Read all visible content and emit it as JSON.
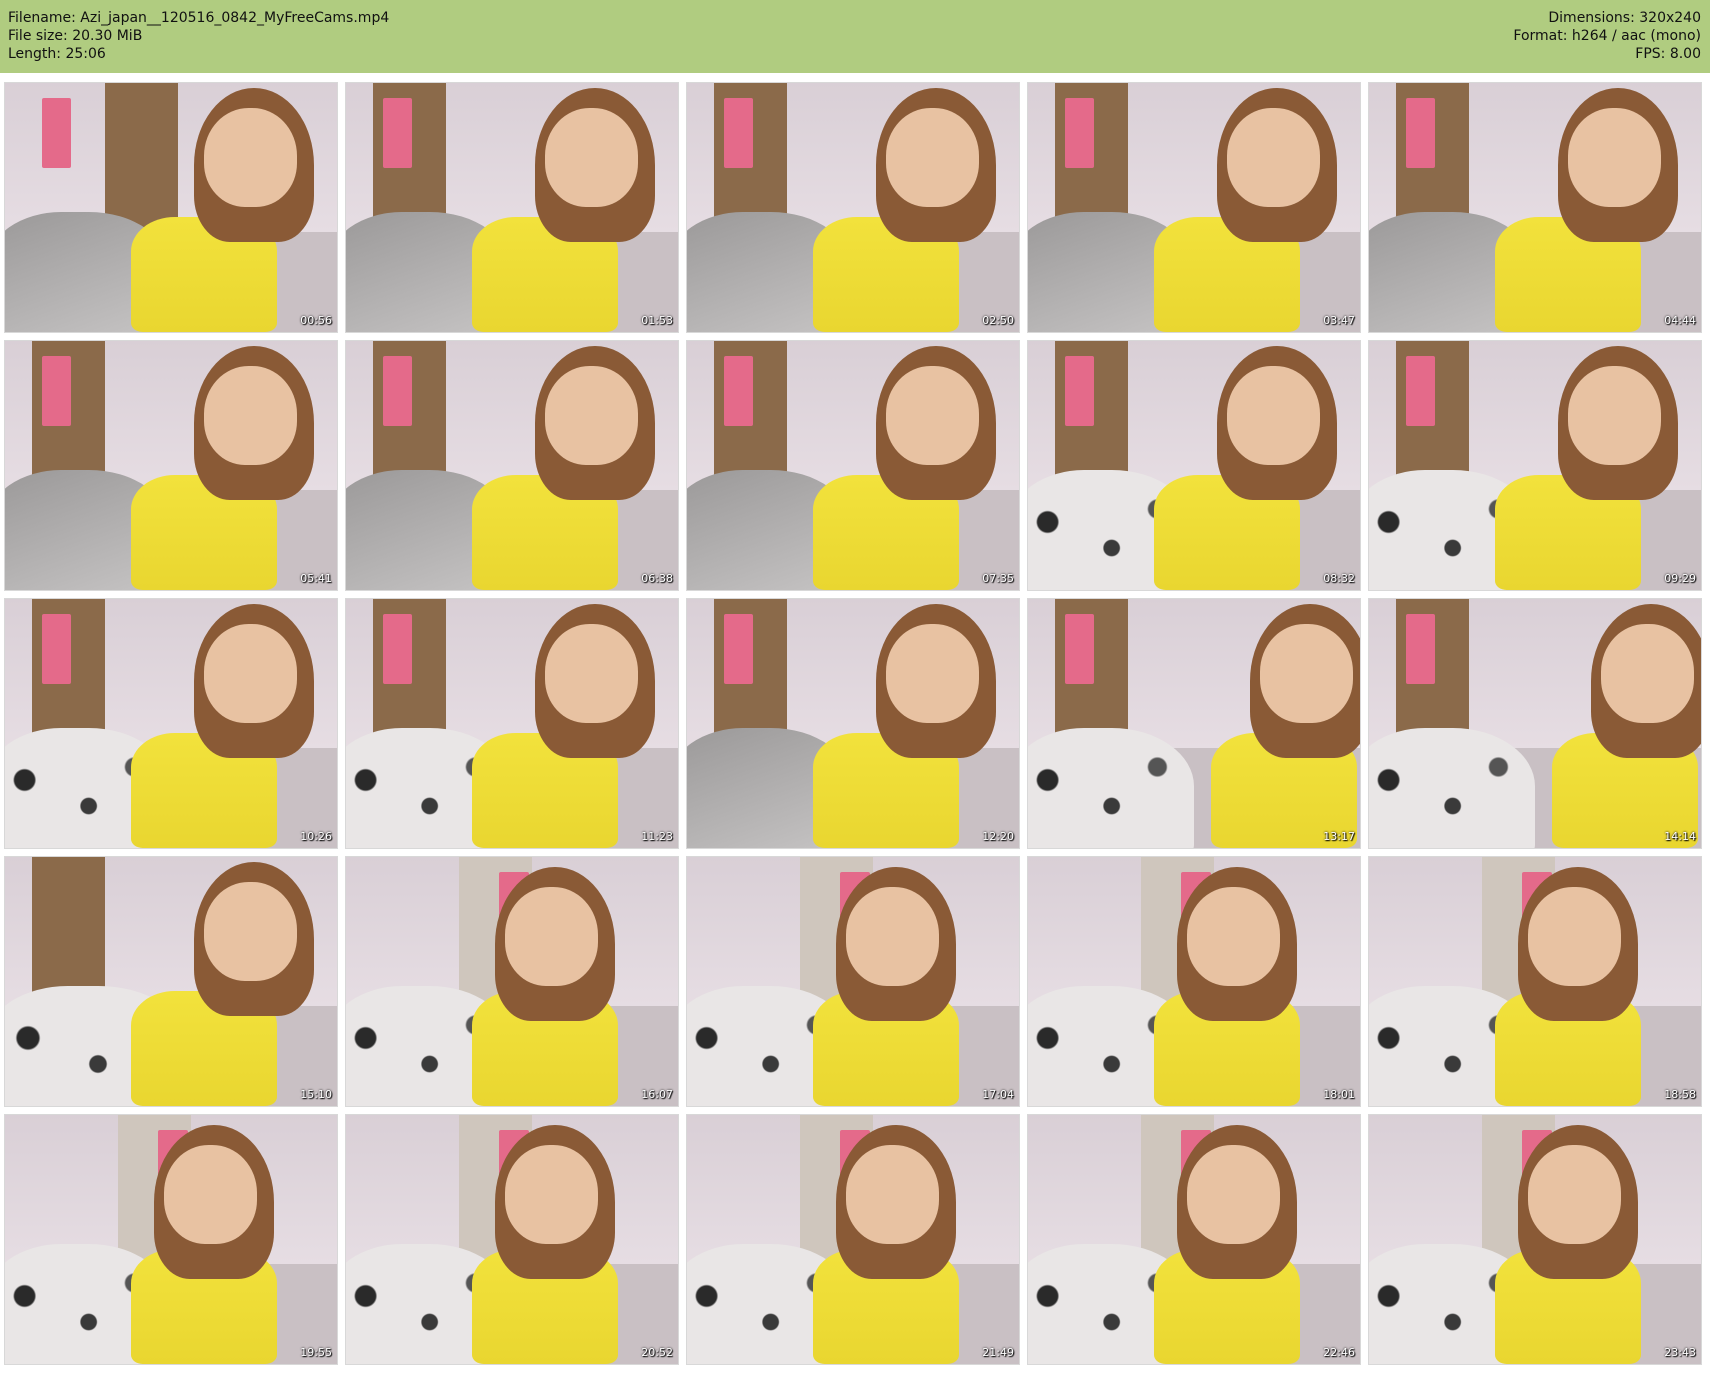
{
  "header": {
    "filename": "Filename: Azi_japan__120516_0842_MyFreeCams.mp4",
    "filesize": "File size: 20.30 MiB",
    "length": "Length: 25:06",
    "dimensions": "Dimensions: 320x240",
    "format": "Format: h264 / aac (mono)",
    "fps": "FPS: 8.00"
  },
  "thumbnails": [
    {
      "time": "00:56",
      "scene": "room-a"
    },
    {
      "time": "01:53",
      "scene": "room-b"
    },
    {
      "time": "02:50",
      "scene": "room-b"
    },
    {
      "time": "03:47",
      "scene": "room-b"
    },
    {
      "time": "04:44",
      "scene": "room-b"
    },
    {
      "time": "05:41",
      "scene": "room-b"
    },
    {
      "time": "06:38",
      "scene": "room-b"
    },
    {
      "time": "07:35",
      "scene": "room-b"
    },
    {
      "time": "08:32",
      "scene": "room-c"
    },
    {
      "time": "09:29",
      "scene": "room-c"
    },
    {
      "time": "10:26",
      "scene": "room-c"
    },
    {
      "time": "11:23",
      "scene": "room-c"
    },
    {
      "time": "12:20",
      "scene": "room-b"
    },
    {
      "time": "13:17",
      "scene": "room-d"
    },
    {
      "time": "14:14",
      "scene": "room-d"
    },
    {
      "time": "15:10",
      "scene": "room-e"
    },
    {
      "time": "16:07",
      "scene": "room-f"
    },
    {
      "time": "17:04",
      "scene": "room-f"
    },
    {
      "time": "18:01",
      "scene": "room-f"
    },
    {
      "time": "18:58",
      "scene": "room-f"
    },
    {
      "time": "19:55",
      "scene": "room-f"
    },
    {
      "time": "20:52",
      "scene": "room-f"
    },
    {
      "time": "21:49",
      "scene": "room-f"
    },
    {
      "time": "22:46",
      "scene": "room-f"
    },
    {
      "time": "23:43",
      "scene": "room-f"
    }
  ],
  "colors": {
    "header_bg": "#b0cc80",
    "shirt": "#f2e23c",
    "skin": "#e8c2a2",
    "hair": "#8a5a36",
    "wall": "#d9cfd6",
    "door": "#8b6a4a",
    "towel": "#e46a8a",
    "blanket_gray": "#9a9898",
    "blanket_pattern": "#e9e6e6"
  }
}
